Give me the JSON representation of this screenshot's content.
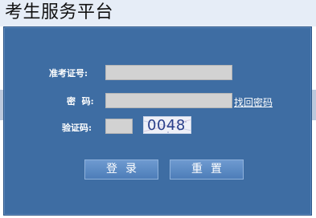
{
  "header": {
    "title": "考生服务平台"
  },
  "login": {
    "exam_id_label": "准考证号:",
    "exam_id_value": "",
    "password_label": "密  码:",
    "password_value": "",
    "forgot_link": "找回密码",
    "captcha_label": "验证码:",
    "captcha_value": "",
    "captcha_image_text": "0048",
    "login_button": "登录",
    "reset_button": "重置"
  },
  "colors": {
    "panel": "#3e6da3",
    "button": "#5b8ac4",
    "field": "#d2d2d2"
  }
}
